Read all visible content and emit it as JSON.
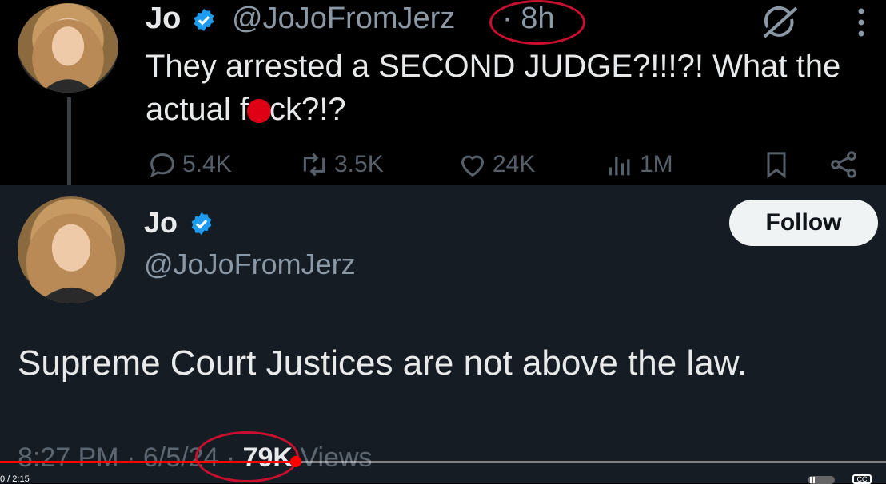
{
  "top_tweet": {
    "name": "Jo",
    "handle": "@JoJoFromJerz",
    "time": "· 8h",
    "text_before": "They arrested a SECOND JUDGE?!!!?! What the actual f",
    "text_after": "ck?!?",
    "reply_count": "5.4K",
    "repost_count": "3.5K",
    "like_count": "24K",
    "view_count": "1M"
  },
  "card": {
    "name": "Jo",
    "handle": "@JoJoFromJerz",
    "follow_label": "Follow",
    "text": "Supreme Court Justices are not above the law.",
    "meta_time": "8:27 PM",
    "meta_sep1": " · ",
    "meta_date": "6/5/24",
    "meta_sep2": " · ",
    "meta_views_count": "79K",
    "meta_views_label": " Views"
  },
  "player": {
    "time_readout": "0 / 2:15",
    "progress_fraction": 0.334,
    "cc_label": "CC"
  },
  "colors": {
    "verified_blue": "#1d9bf0",
    "annotation_red": "#c8102e",
    "progress_red": "#ff0000",
    "card_bg": "#161c24"
  },
  "icons": [
    "verified-badge-icon",
    "grok-icon",
    "more-icon",
    "reply-icon",
    "repost-icon",
    "like-icon",
    "views-icon",
    "bookmark-icon",
    "share-icon",
    "pause-icon",
    "cc-icon"
  ]
}
